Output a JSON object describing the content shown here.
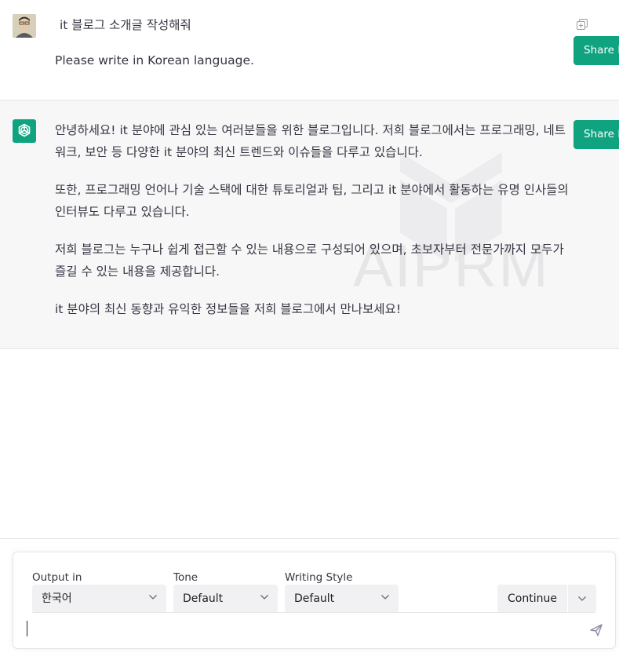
{
  "user_message": {
    "line1": "it 블로그 소개글 작성해줘",
    "line2": "Please write in Korean language."
  },
  "share_label": "Share P",
  "assistant_message": {
    "paragraphs": [
      "안녕하세요! it 분야에 관심 있는 여러분들을 위한 블로그입니다. 저희 블로그에서는 프로그래밍, 네트워크, 보안 등 다양한 it 분야의 최신 트렌드와 이슈들을 다루고 있습니다.",
      "또한, 프로그래밍 언어나 기술 스택에 대한 튜토리얼과 팁, 그리고 it 분야에서 활동하는 유명 인사들의 인터뷰도 다루고 있습니다.",
      "저희 블로그는 누구나 쉽게 접근할 수 있는 내용으로 구성되어 있으며, 초보자부터 전문가까지 모두가 즐길 수 있는 내용을 제공합니다.",
      "it 분야의 최신 동향과 유익한 정보들을 저희 블로그에서 만나보세요!"
    ]
  },
  "watermark": "AIPRM",
  "prompt_panel": {
    "output_label": "Output in",
    "output_value": "한국어",
    "tone_label": "Tone",
    "tone_value": "Default",
    "style_label": "Writing Style",
    "style_value": "Default",
    "continue_label": "Continue"
  },
  "colors": {
    "accent": "#10a37f",
    "assistant_bg": "#f7f7f8"
  }
}
